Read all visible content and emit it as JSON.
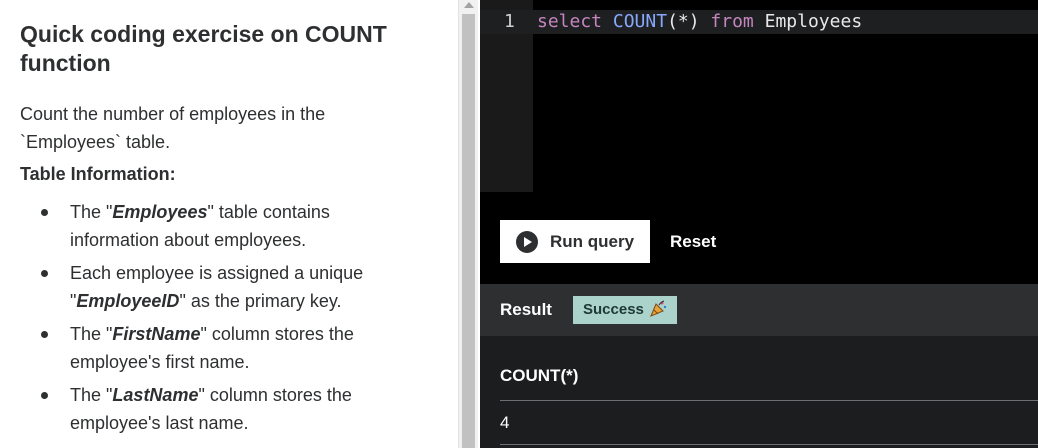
{
  "exercise": {
    "title": "Quick coding exercise on COUNT function",
    "description": "Count the number of employees in the `Employees` table.",
    "table_info_heading": "Table Information:",
    "bullets": [
      {
        "pre": "The \"",
        "em": "Employees",
        "post": "\" table contains information about employees."
      },
      {
        "pre": "Each employee is assigned a unique \"",
        "em": "EmployeeID",
        "post": "\" as the primary key."
      },
      {
        "pre": "The \"",
        "em": "FirstName",
        "post": "\" column stores the employee's first name."
      },
      {
        "pre": "The \"",
        "em": "LastName",
        "post": "\" column stores the employee's last name."
      }
    ]
  },
  "editor": {
    "line_number": "1",
    "tokens": {
      "kw_select": "select",
      "fn_count": "COUNT",
      "args": "(*)",
      "kw_from": "from",
      "table": "Employees"
    }
  },
  "actions": {
    "run_label": "Run query",
    "reset_label": "Reset"
  },
  "result": {
    "label": "Result",
    "status": "Success",
    "status_icon": "party-popper-icon",
    "columns": [
      "COUNT(*)"
    ],
    "rows": [
      [
        "4"
      ]
    ]
  },
  "colors": {
    "editor_bg": "#000000",
    "panel_bg": "#1c1d1f",
    "keyword": "#c586c0",
    "function": "#86a8ff",
    "success_badge": "#acd2cc"
  }
}
